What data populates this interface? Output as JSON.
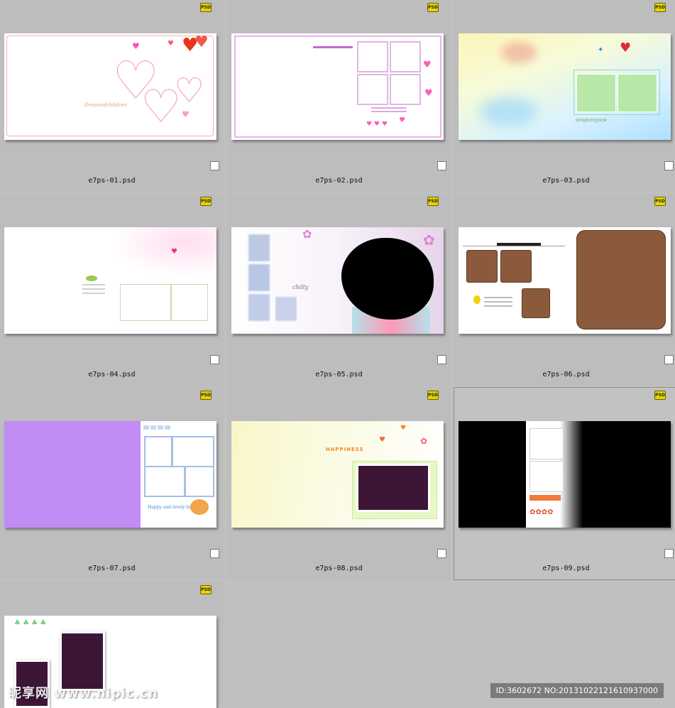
{
  "badge_label": "PSD",
  "files": [
    {
      "name": "e7ps-01.psd",
      "selected": false
    },
    {
      "name": "e7ps-02.psd",
      "selected": false
    },
    {
      "name": "e7ps-03.psd",
      "selected": false
    },
    {
      "name": "e7ps-04.psd",
      "selected": false
    },
    {
      "name": "e7ps-05.psd",
      "selected": false
    },
    {
      "name": "e7ps-06.psd",
      "selected": false
    },
    {
      "name": "e7ps-07.psd",
      "selected": false
    },
    {
      "name": "e7ps-08.psd",
      "selected": false
    },
    {
      "name": "e7ps-09.psd",
      "selected": true
    },
    {
      "name": "",
      "selected": false
    }
  ],
  "thumb_text": {
    "t01": "Dreamofchildren",
    "t03": "singlanyyaw",
    "t05": "chilty",
    "t07": "Happy and lovely baby",
    "t08": "HAPPINESS"
  },
  "watermark": {
    "logo": "昵享网 www.nipic.cn",
    "id": "ID:3602672 NO:20131022121610937000"
  },
  "colors": {
    "background": "#c0c0c0",
    "purple_block": "#c18cf4",
    "brown_frame": "#8b5a3c",
    "dark_frame": "#3d1636",
    "badge": "#e6d400"
  }
}
